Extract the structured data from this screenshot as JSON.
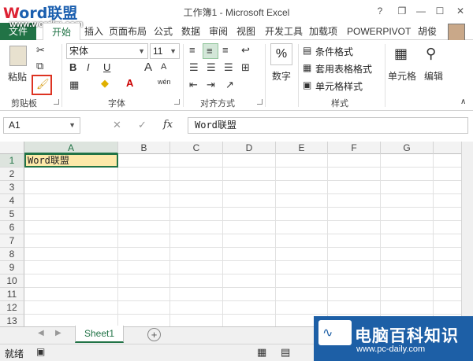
{
  "watermark": {
    "brand_w": "W",
    "brand_rest": "ord联盟",
    "url": "www.wordlm.com"
  },
  "window": {
    "title": "工作簿1 - Microsoft Excel",
    "help": "?",
    "restore": "❐",
    "minimize": "—",
    "maximize": "☐",
    "close": "✕"
  },
  "tabs": {
    "file": "文件",
    "home": "开始",
    "items": [
      "插入",
      "页面布局",
      "公式",
      "数据",
      "审阅",
      "视图",
      "开发工具",
      "加载项",
      "POWERPIVOT"
    ],
    "user": "胡俊"
  },
  "ribbon": {
    "clipboard": {
      "paste": "粘贴",
      "label": "剪贴板"
    },
    "font": {
      "name": "宋体",
      "size": "11",
      "bold": "B",
      "italic": "I",
      "underline": "U",
      "grow": "A",
      "shrink": "A",
      "wen": "wén",
      "color_a": "A",
      "label": "字体"
    },
    "align": {
      "label": "对齐方式"
    },
    "number": {
      "btn": "数字",
      "symbol": "%"
    },
    "styles": {
      "cond": "条件格式",
      "table": "套用表格格式",
      "cell": "单元格样式",
      "label": "样式"
    },
    "cells": {
      "btn": "单元格"
    },
    "editing": {
      "btn": "编辑"
    }
  },
  "formula_bar": {
    "name_box": "A1",
    "cancel": "✕",
    "enter": "✓",
    "fx": "fx",
    "content": "Word联盟"
  },
  "grid": {
    "columns": [
      "A",
      "B",
      "C",
      "D",
      "E",
      "F",
      "G"
    ],
    "rows": [
      "1",
      "2",
      "3",
      "4",
      "5",
      "6",
      "7",
      "8",
      "9",
      "10",
      "11",
      "12",
      "13"
    ],
    "a1_value": "Word联盟"
  },
  "sheets": {
    "tabs": [
      "Sheet1"
    ],
    "add": "+"
  },
  "status": {
    "ready": "就绪"
  },
  "brand_logo": {
    "name": "电脑百科知识",
    "url": "www.pc-daily.com"
  },
  "colors": {
    "accent": "#217346",
    "selected_fill": "#fde9a9"
  }
}
